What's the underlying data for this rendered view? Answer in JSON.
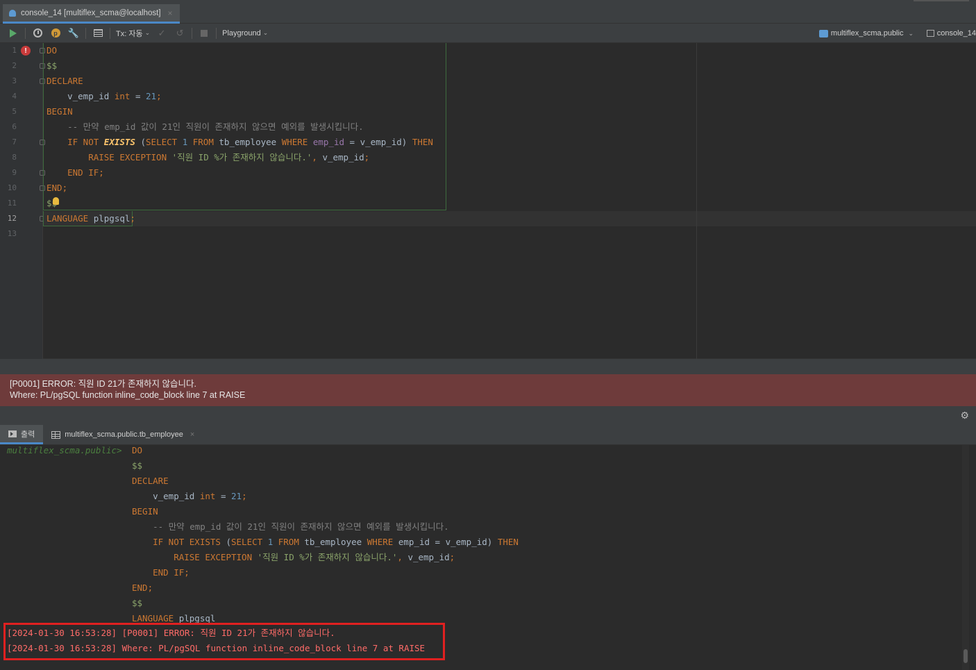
{
  "tab": {
    "title": "console_14 [multiflex_scma@localhost]",
    "close": "×"
  },
  "toolbar": {
    "tx_label": "Tx: 자동",
    "playground_label": "Playground",
    "schema_label": "multiflex_scma.public",
    "console_label": "console_14"
  },
  "editor": {
    "line_numbers": [
      "1",
      "2",
      "3",
      "4",
      "5",
      "6",
      "7",
      "8",
      "9",
      "10",
      "11",
      "12",
      "13"
    ]
  },
  "error_banner": {
    "line1": "[P0001] ERROR: 직원 ID 21가 존재하지 않습니다.",
    "line2": "Where: PL/pgSQL function inline_code_block line 7 at RAISE"
  },
  "bottom_tabs": {
    "output_label": "출력",
    "table_label": "multiflex_scma.public.tb_employee",
    "close": "×"
  },
  "console": {
    "prompt": "multiflex_scma.public>",
    "error_lines": [
      "[2024-01-30 16:53:28] [P0001] ERROR: 직원 ID 21가 존재하지 않습니다.",
      "[2024-01-30 16:53:28] Where: PL/pgSQL function inline_code_block line 7 at RAISE"
    ]
  }
}
